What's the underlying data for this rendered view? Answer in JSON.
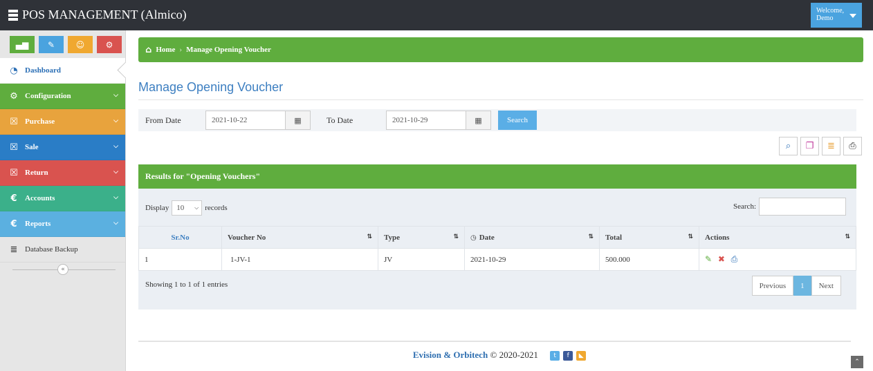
{
  "app": {
    "title": "POS MANAGEMENT (Almico)",
    "welcome_line1": "Welcome,",
    "welcome_line2": "Demo"
  },
  "shortcuts": [
    {
      "icon": "bar-chart-icon",
      "glyph": "▄▆",
      "color": "#5fad3e"
    },
    {
      "icon": "pencil-icon",
      "glyph": "✎",
      "color": "#4aa3df"
    },
    {
      "icon": "users-icon",
      "glyph": "☺",
      "color": "#f0a830"
    },
    {
      "icon": "cogs-icon",
      "glyph": "⚙",
      "color": "#d9534f"
    }
  ],
  "sidebar": {
    "items": [
      {
        "label": "Dashboard",
        "icon": "dashboard-icon",
        "glyph": "◔",
        "color": "#ffffff"
      },
      {
        "label": "Configuration",
        "icon": "cogs-icon",
        "glyph": "⚙",
        "color": "#5fad3e"
      },
      {
        "label": "Purchase",
        "icon": "cart-icon",
        "glyph": "☒",
        "color": "#e8a33d"
      },
      {
        "label": "Sale",
        "icon": "cart-icon",
        "glyph": "☒",
        "color": "#2a7dc6"
      },
      {
        "label": "Return",
        "icon": "cart-icon",
        "glyph": "☒",
        "color": "#d9534f"
      },
      {
        "label": "Accounts",
        "icon": "euro-icon",
        "glyph": "€",
        "color": "#3bb08a"
      },
      {
        "label": "Reports",
        "icon": "euro-icon",
        "glyph": "€",
        "color": "#5bb0e0"
      },
      {
        "label": "Database Backup",
        "icon": "database-icon",
        "glyph": "≣",
        "color": "#e6e6e6"
      }
    ]
  },
  "breadcrumb": {
    "home": "Home",
    "separator": "›",
    "current": "Manage Opening Voucher"
  },
  "page": {
    "title": "Manage Opening Voucher"
  },
  "filter": {
    "from_label": "From Date",
    "from_value": "2021-10-22",
    "to_label": "To Date",
    "to_value": "2021-10-29",
    "search_label": "Search"
  },
  "results": {
    "heading": "Results for \"Opening Vouchers\"",
    "display_label": "Display",
    "page_size": "10",
    "records_label": "records",
    "search_label": "Search:",
    "columns": [
      "Sr.No",
      "Voucher No",
      "Type",
      "Date",
      "Total",
      "Actions"
    ],
    "rows": [
      {
        "srno": "1",
        "voucher_no": "1-JV-1",
        "type": "JV",
        "date": "2021-10-29",
        "total": "500.000"
      }
    ],
    "showing": "Showing 1 to 1 of 1 entries",
    "pager": {
      "prev": "Previous",
      "current": "1",
      "next": "Next"
    }
  },
  "footer": {
    "brand": "Evision & Orbitech",
    "copyright": "© 2020-2021"
  },
  "colors": {
    "accent_green": "#5fad3e",
    "accent_blue": "#3d7fc1",
    "topbar": "#2f3238"
  }
}
